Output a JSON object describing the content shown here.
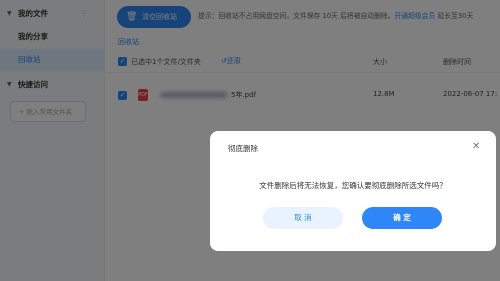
{
  "sidebar": {
    "items": [
      {
        "label": "我的文件"
      },
      {
        "label": "我的分享"
      },
      {
        "label": "回收站"
      },
      {
        "label": "快捷访问"
      }
    ],
    "add_folder_label": "+ 拖入常用文件夹"
  },
  "toolbar": {
    "restore_label": "清空回收站",
    "tip_text": "提示：回收站不占用网盘空间，文件保存 10天 后将被自动删除。",
    "tip_link": "开通超级会员",
    "tip_suffix": " 延长至30天"
  },
  "breadcrumb": "回收站",
  "table": {
    "selection_text": "已选中1个文件/文件夹",
    "restore_action": "还原",
    "headers": {
      "size": "大小",
      "deleted_time": "删除时间"
    },
    "rows": [
      {
        "name_suffix": "5年.pdf",
        "size": "12.8M",
        "deleted": "2022-06-07 17:"
      }
    ]
  },
  "dialog": {
    "title": "彻底删除",
    "message": "文件删除后将无法恢复，您确认要彻底删除所选文件吗？",
    "cancel_label": "取 消",
    "confirm_label": "确 定"
  },
  "colors": {
    "accent": "#2f86f6",
    "overlay": "rgba(0,0,0,0.5)"
  }
}
